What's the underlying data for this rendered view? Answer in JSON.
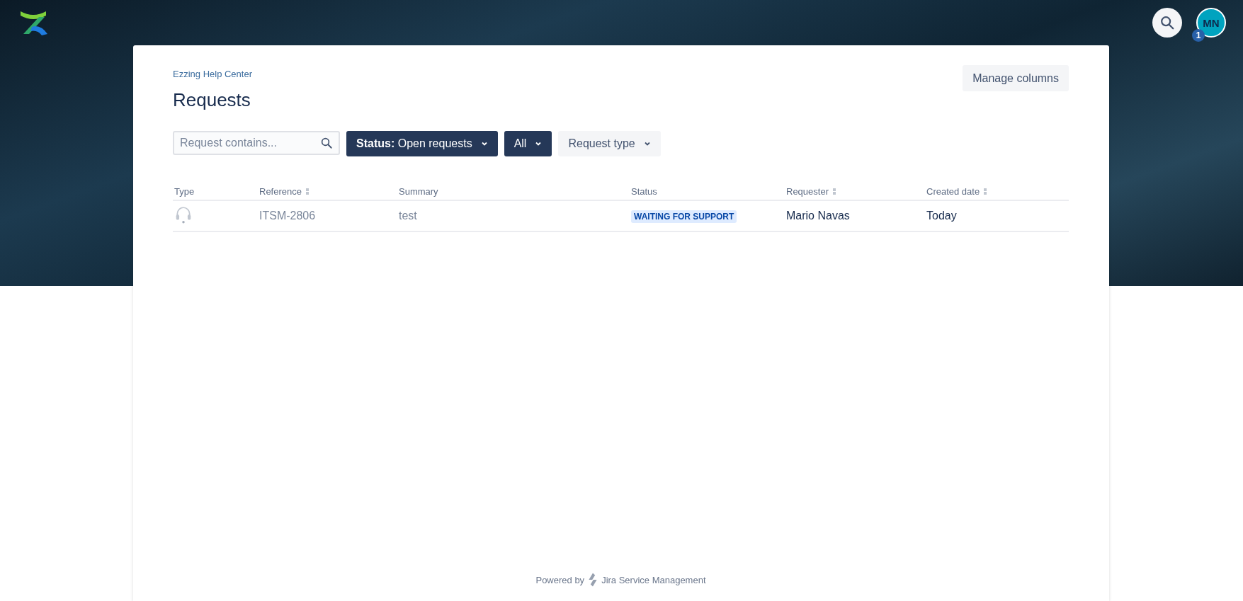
{
  "header": {
    "avatar_initials": "MN",
    "notification_count": "1"
  },
  "breadcrumb": "Ezzing Help Center",
  "title": "Requests",
  "manage_columns": "Manage columns",
  "search": {
    "placeholder": "Request contains..."
  },
  "filters": [
    {
      "label": "**Status:** Open requests",
      "active": true
    },
    {
      "label": "All",
      "active": true
    },
    {
      "label": "Request type",
      "active": false
    }
  ],
  "table": {
    "columns": [
      {
        "label": "Type",
        "sortable": false
      },
      {
        "label": "Reference",
        "sortable": true
      },
      {
        "label": "Summary",
        "sortable": false
      },
      {
        "label": "Status",
        "sortable": false
      },
      {
        "label": "Requester",
        "sortable": true
      },
      {
        "label": "Created date",
        "sortable": true
      }
    ],
    "rows": [
      {
        "reference": "ITSM-2806",
        "summary": "test",
        "status": "WAITING FOR SUPPORT",
        "requester": "Mario Navas",
        "created": "Today"
      }
    ]
  },
  "footer": {
    "prefix": "Powered by",
    "product": "Jira Service Management"
  }
}
